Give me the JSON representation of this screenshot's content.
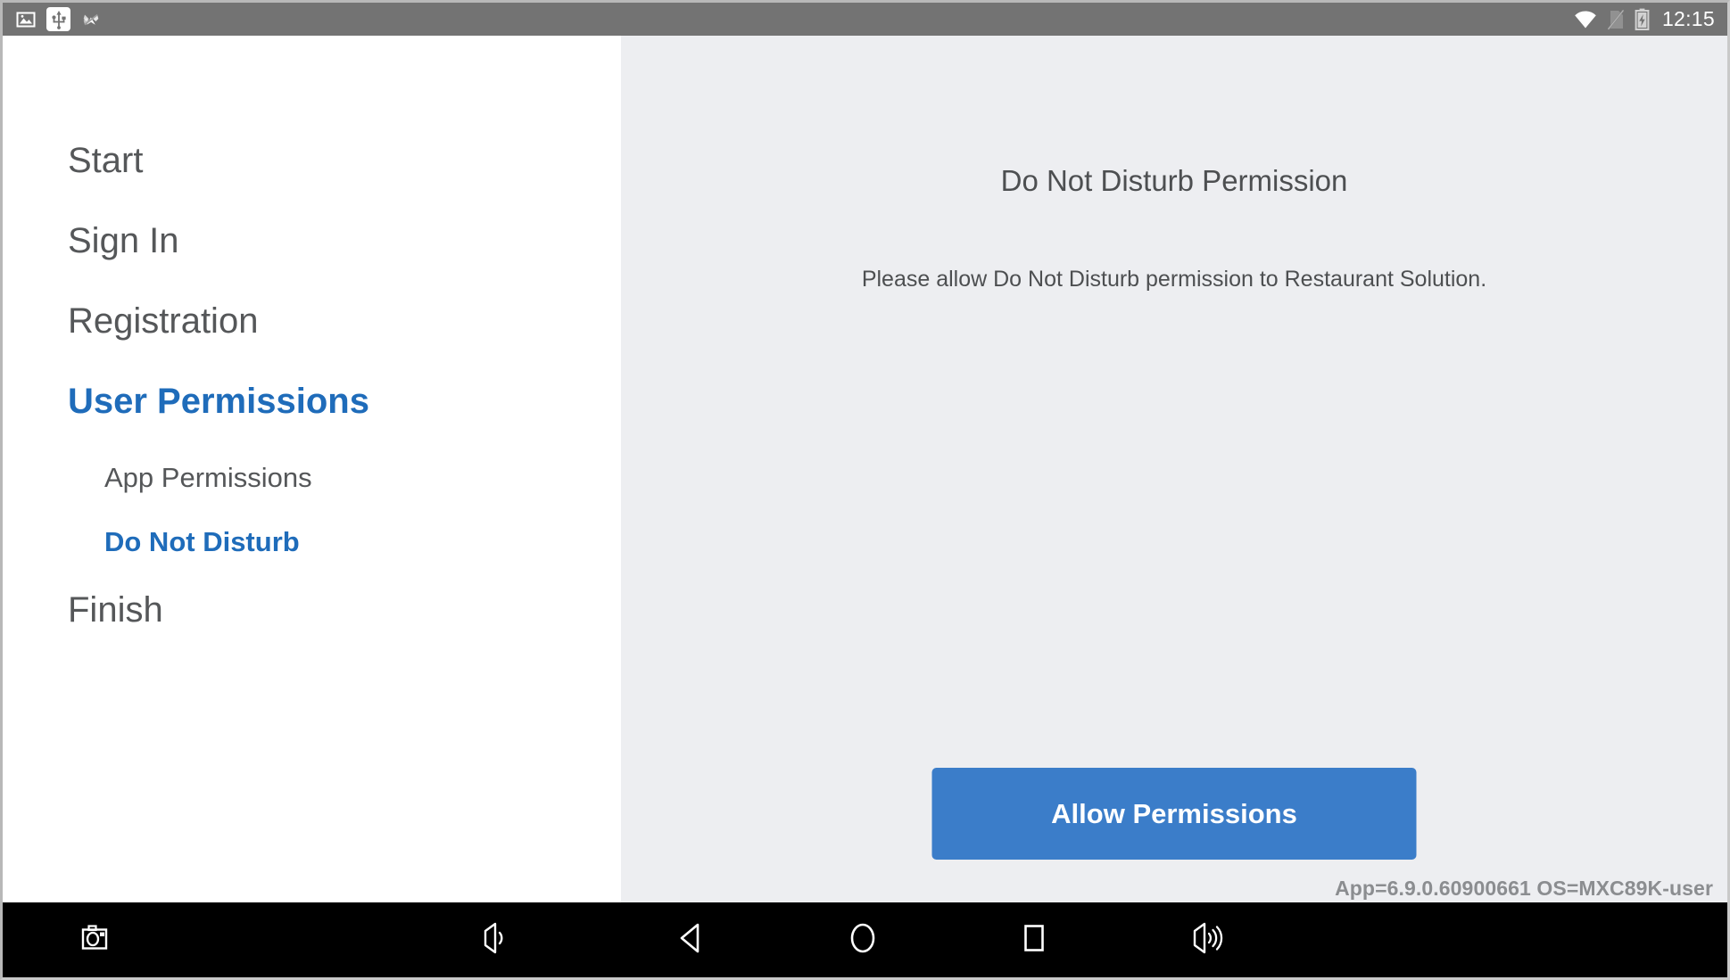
{
  "status_bar": {
    "left_icons": [
      {
        "name": "screenshot-image-icon",
        "label": "Screenshot saved"
      },
      {
        "name": "usb-icon",
        "label": "USB connected"
      },
      {
        "name": "muted-cross-icon",
        "label": "Sound off"
      }
    ],
    "right_icons": [
      {
        "name": "wifi-icon",
        "label": "Wi-Fi connected"
      },
      {
        "name": "no-sim-icon",
        "label": "No SIM card"
      },
      {
        "name": "battery-charging-icon",
        "label": "Battery charging"
      }
    ],
    "clock": "12:15"
  },
  "sidebar": {
    "items": [
      {
        "label": "Start",
        "level": "top",
        "active": false
      },
      {
        "label": "Sign In",
        "level": "top",
        "active": false
      },
      {
        "label": "Registration",
        "level": "top",
        "active": false
      },
      {
        "label": "User Permissions",
        "level": "top",
        "active": true
      },
      {
        "label": "App Permissions",
        "level": "sub",
        "active": false
      },
      {
        "label": "Do Not Disturb",
        "level": "sub",
        "active": true
      },
      {
        "label": "Finish",
        "level": "top",
        "active": false
      }
    ]
  },
  "main": {
    "title": "Do Not Disturb Permission",
    "description": "Please allow Do Not Disturb permission to Restaurant Solution.",
    "primary_button": "Allow Permissions",
    "version_info": "App=6.9.0.60900661 OS=MXC89K-user"
  },
  "nav_bar": {
    "buttons": [
      {
        "name": "screenshot-button",
        "label": "Screenshot"
      },
      {
        "name": "volume-down-button",
        "label": "Volume down"
      },
      {
        "name": "back-button",
        "label": "Back"
      },
      {
        "name": "home-button",
        "label": "Home"
      },
      {
        "name": "recents-button",
        "label": "Recent apps"
      },
      {
        "name": "volume-up-button",
        "label": "Volume up"
      }
    ]
  },
  "colors": {
    "accent_blue": "#1f6cba",
    "button_blue": "#3b7dc9",
    "status_bar_gray": "#737373",
    "panel_gray": "#edeef1",
    "text_gray": "#555759",
    "version_gray": "#8b8d90",
    "nav_bar_black": "#000000"
  }
}
